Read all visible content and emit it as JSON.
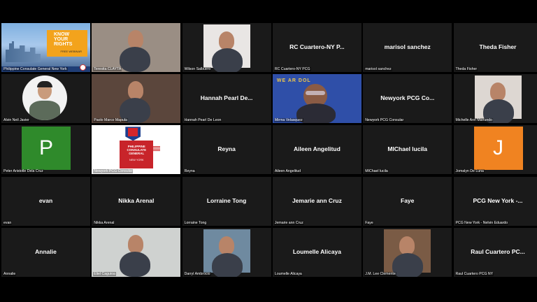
{
  "participants": [
    {
      "label": "Philippine Consulate General New York",
      "type": "poster",
      "poster_text": "KNOW YOUR RIGHTS",
      "poster_sub": "FREE WEBINAR"
    },
    {
      "label": "Teresita CLAYTA",
      "type": "video",
      "bg": "#9a8e84"
    },
    {
      "label": "Wilson Salbuero",
      "type": "photo",
      "bg": "#e9e6e4"
    },
    {
      "label": "RC Cuartero-NY PCG",
      "type": "name",
      "display": "RC Cuartero-NY P..."
    },
    {
      "label": "marisol sanchez",
      "type": "name",
      "display": "marisol sanchez"
    },
    {
      "label": "Theda Fisher",
      "type": "name",
      "display": "Theda Fisher"
    },
    {
      "label": "Alvin Neil Javier",
      "type": "circle",
      "bg": "#f2f2f2"
    },
    {
      "label": "Paolo Marco Mapula",
      "type": "video",
      "bg": "#5b463c"
    },
    {
      "label": "Hannah Pearl De Leon",
      "type": "name",
      "display": "Hannah Pearl De..."
    },
    {
      "label": "Mirma Velasquez",
      "type": "banner",
      "banner_text": "WE AR  DOL",
      "bg": "#2f4fa8"
    },
    {
      "label": "Newyork PCG Consular",
      "type": "name",
      "display": "Newyork PCG Co..."
    },
    {
      "label": "Michelle Ann Manundo",
      "type": "photo",
      "bg": "#ddd7d2"
    },
    {
      "label": "Peter Aristotle Dela Cruz",
      "type": "avatar",
      "letter": "P",
      "color": "#2f8a2b"
    },
    {
      "label": "Newyork PCG Consular",
      "type": "seal",
      "seal_text": "PHILIPPINE CONSULATE GENERAL",
      "seal_sub": "NEW YORK"
    },
    {
      "label": "Reyna",
      "type": "name",
      "display": "Reyna"
    },
    {
      "label": "Aileen Angelitud",
      "type": "name",
      "display": "Aileen Angelitud"
    },
    {
      "label": "MIChael lucila",
      "type": "name",
      "display": "MIChael lucila"
    },
    {
      "label": "Jomalyn De Luna",
      "type": "avatar",
      "letter": "J",
      "color": "#f08321"
    },
    {
      "label": "evan",
      "type": "name",
      "display": "evan"
    },
    {
      "label": "Nikka Arenal",
      "type": "name",
      "display": "Nikka Arenal"
    },
    {
      "label": "Lorraine Tong",
      "type": "name",
      "display": "Lorraine Tong"
    },
    {
      "label": "Jemarie ann Cruz",
      "type": "name",
      "display": "Jemarie ann Cruz"
    },
    {
      "label": "Faye",
      "type": "name",
      "display": "Faye"
    },
    {
      "label": "PCG New York - Nelvin Eduardo",
      "type": "name",
      "display": "PCG New York -..."
    },
    {
      "label": "Annalie",
      "type": "name",
      "display": "Annalie"
    },
    {
      "label": "Eliel Caguioa",
      "type": "video",
      "bg": "#cfd2d0"
    },
    {
      "label": "Darryl Ambrocio",
      "type": "photo",
      "bg": "#6f8aa0"
    },
    {
      "label": "Loumelle Alicaya",
      "type": "name",
      "display": "Loumelle Alicaya"
    },
    {
      "label": "J.M. Lee Clemente",
      "type": "photo",
      "bg": "#7a5b45"
    },
    {
      "label": "Raul Cuartero PCG NY",
      "type": "name",
      "display": "Raul Cuartero PC..."
    }
  ],
  "colors": {
    "tile": "#1a1a1a",
    "background": "#000000",
    "accent": "#2f8a2b"
  }
}
